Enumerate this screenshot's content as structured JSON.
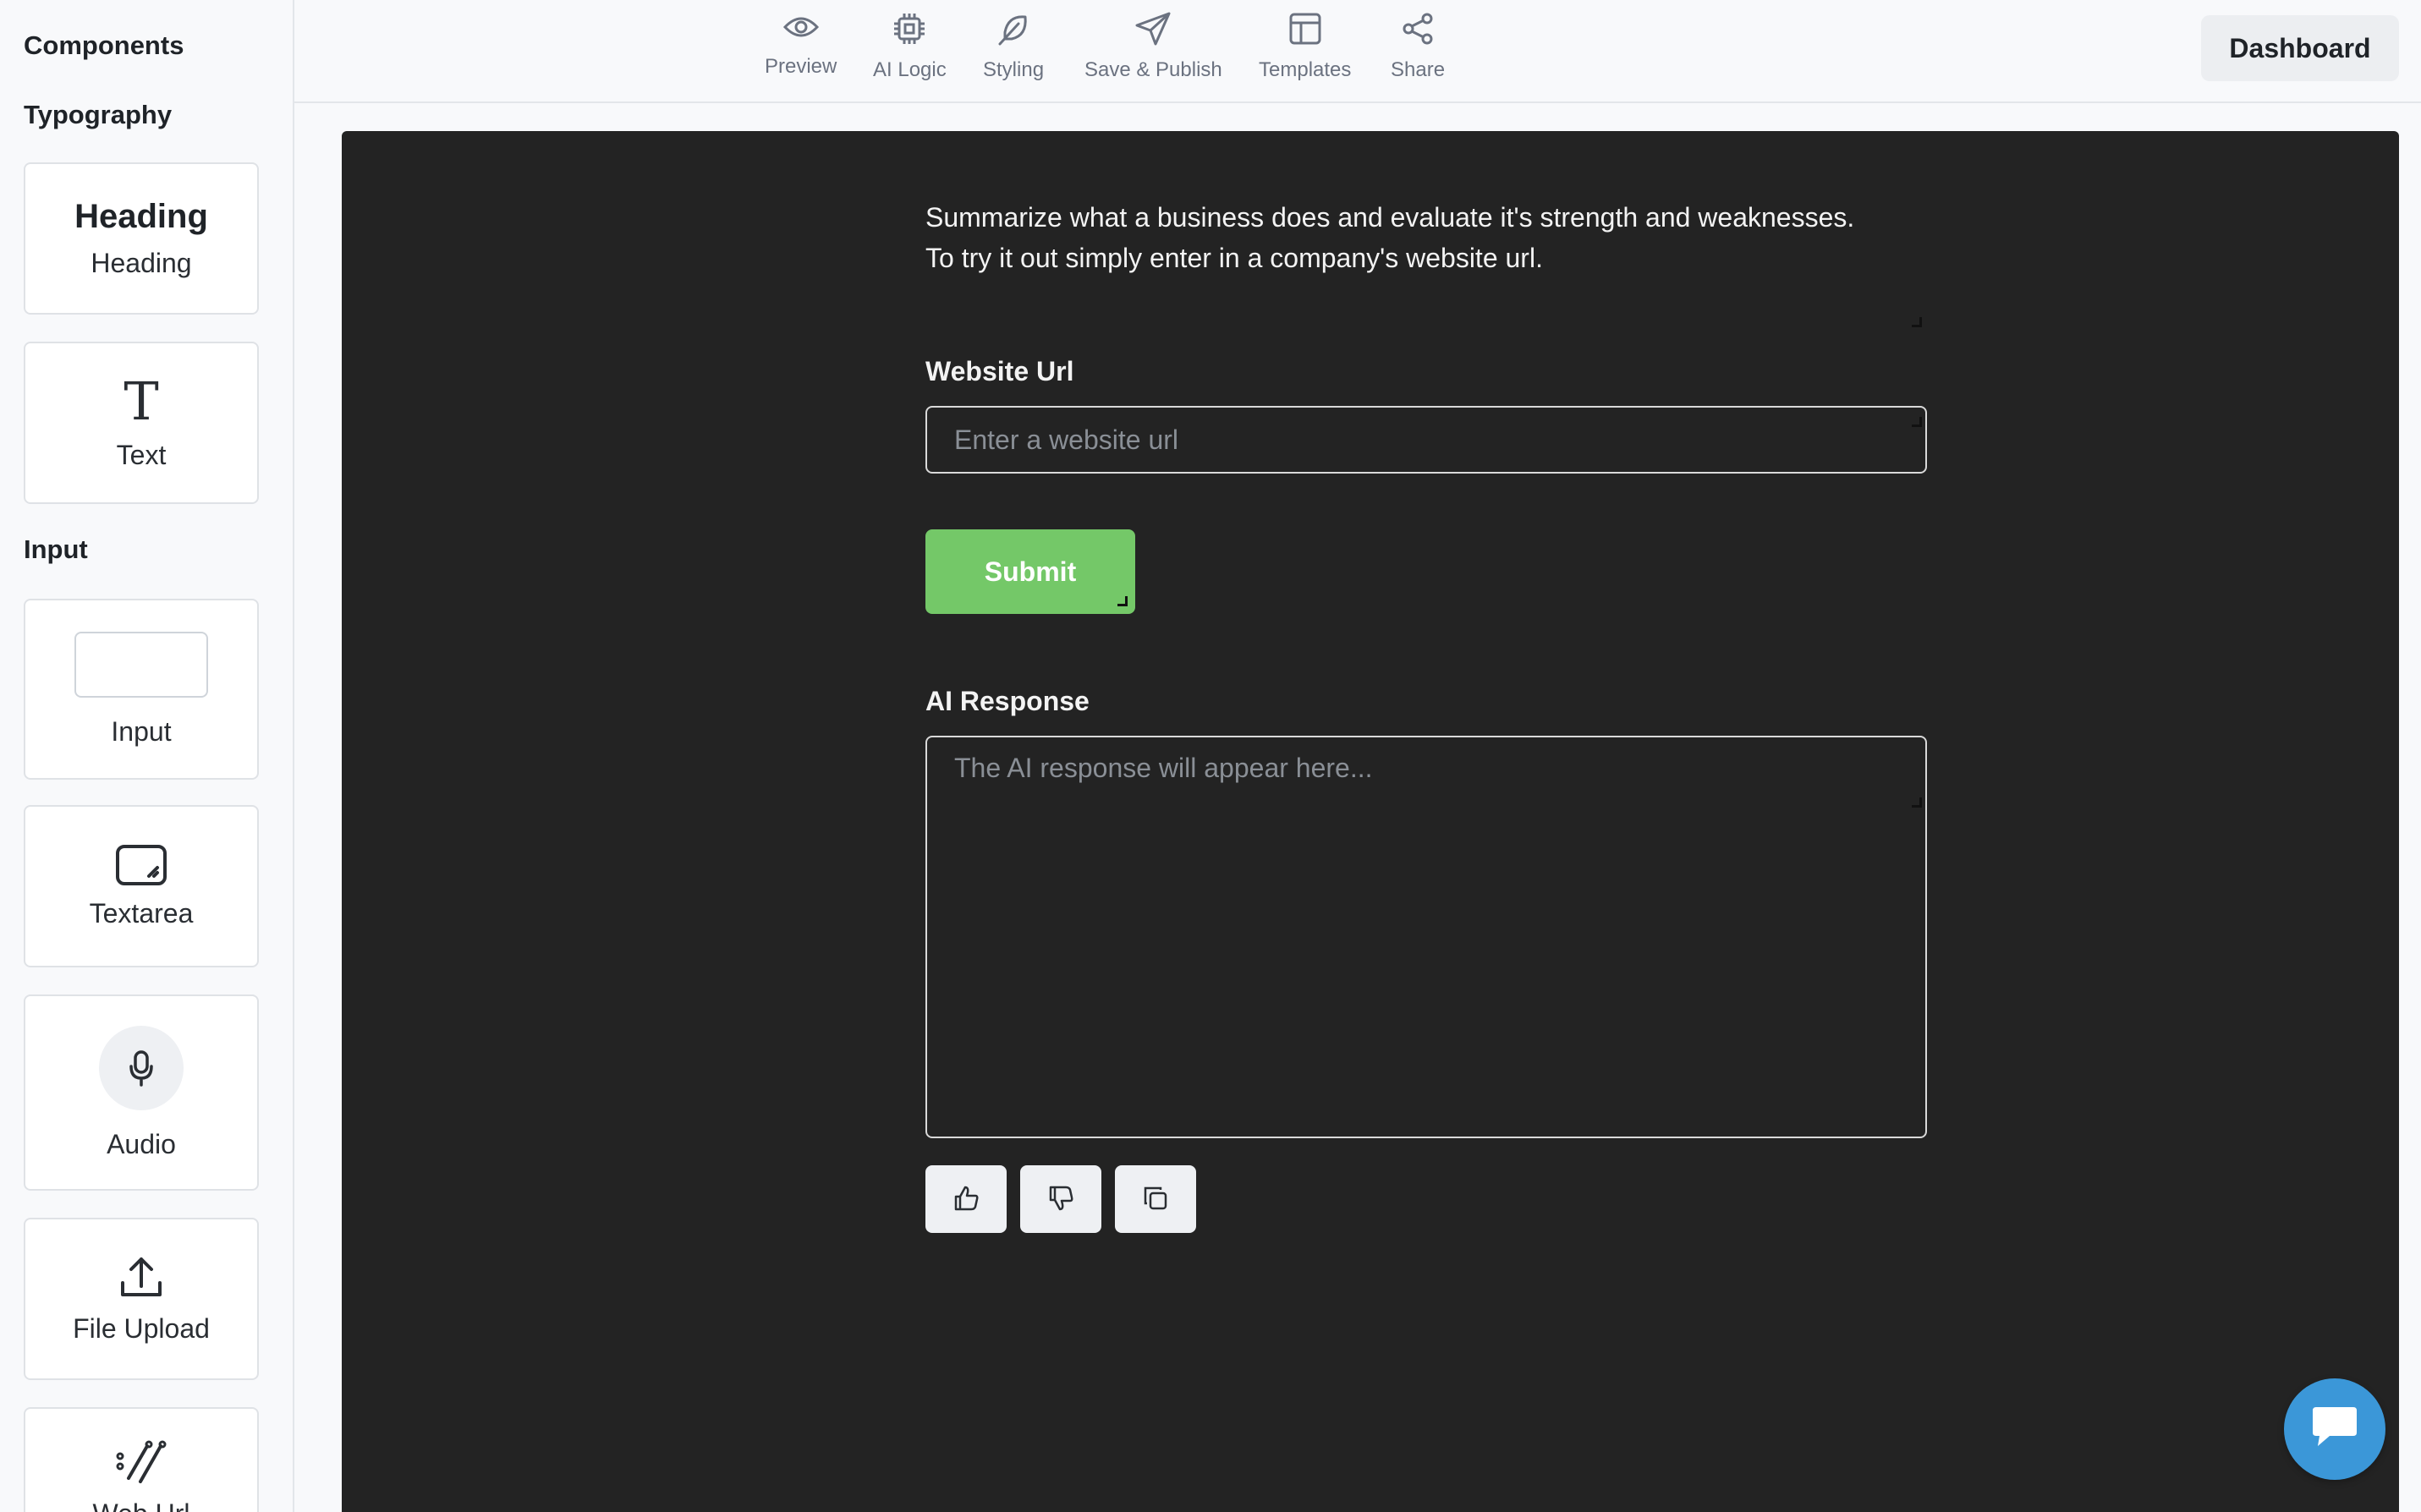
{
  "sidebar": {
    "title": "Components",
    "sections": {
      "typography": "Typography",
      "input": "Input"
    },
    "items": {
      "heading_preview": "Heading",
      "heading_label": "Heading",
      "text_glyph": "T",
      "text_label": "Text",
      "input_label": "Input",
      "textarea_label": "Textarea",
      "audio_label": "Audio",
      "file_upload_label": "File Upload",
      "partial_label": "Web Url"
    }
  },
  "toolbar": {
    "preview": "Preview",
    "ai_logic": "AI Logic",
    "styling": "Styling",
    "save_publish": "Save & Publish",
    "templates": "Templates",
    "share": "Share",
    "dashboard": "Dashboard"
  },
  "canvas": {
    "description_line1": "Summarize what a business does and evaluate it's strength and weaknesses.",
    "description_line2": "To try it out simply enter in a company's website url.",
    "website_label": "Website Url",
    "website_placeholder": "Enter a website url",
    "website_value": "",
    "submit_label": "Submit",
    "response_label": "AI Response",
    "response_placeholder": "The AI response will appear here...",
    "response_value": ""
  },
  "icons": {
    "preview": "eye-icon",
    "ai_logic": "chip-icon",
    "styling": "feather-icon",
    "save_publish": "send-icon",
    "templates": "layout-icon",
    "share": "share-icon",
    "thumbs_up": "thumbs-up-icon",
    "thumbs_down": "thumbs-down-icon",
    "copy": "copy-icon",
    "chat": "chat-icon"
  },
  "colors": {
    "canvas_bg": "#232323",
    "submit_bg": "#74c868",
    "chat_bg": "#3b97d8"
  }
}
